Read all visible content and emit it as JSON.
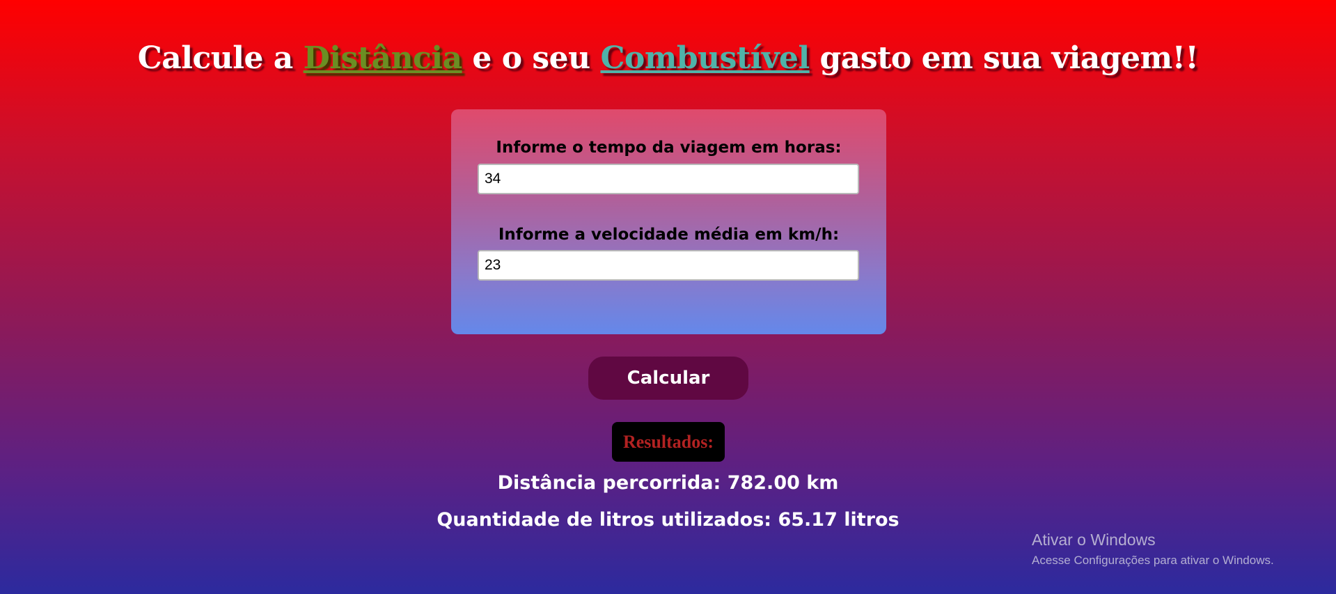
{
  "header": {
    "prefix": "Calcule a ",
    "highlight_1": "Distância",
    "middle": " e o seu ",
    "highlight_2": "Combustível",
    "suffix": " gasto em sua viagem!!"
  },
  "form": {
    "time_label": "Informe o tempo da viagem em horas:",
    "time_value": "34",
    "speed_label": "Informe a velocidade média em km/h:",
    "speed_value": "23"
  },
  "actions": {
    "calculate_label": "Calcular"
  },
  "results": {
    "badge_label": "Resultados:",
    "distance_text": "Distância percorrida: 782.00 km",
    "fuel_text": "Quantidade de litros utilizados: 65.17 litros"
  },
  "watermark": {
    "title": "Ativar o Windows",
    "subtitle": "Acesse Configurações para ativar o Windows."
  },
  "colors": {
    "highlight_1": "#6b8e23",
    "highlight_2": "#4fb3a9",
    "button_bg": "#600842",
    "badge_text": "#b22222"
  }
}
